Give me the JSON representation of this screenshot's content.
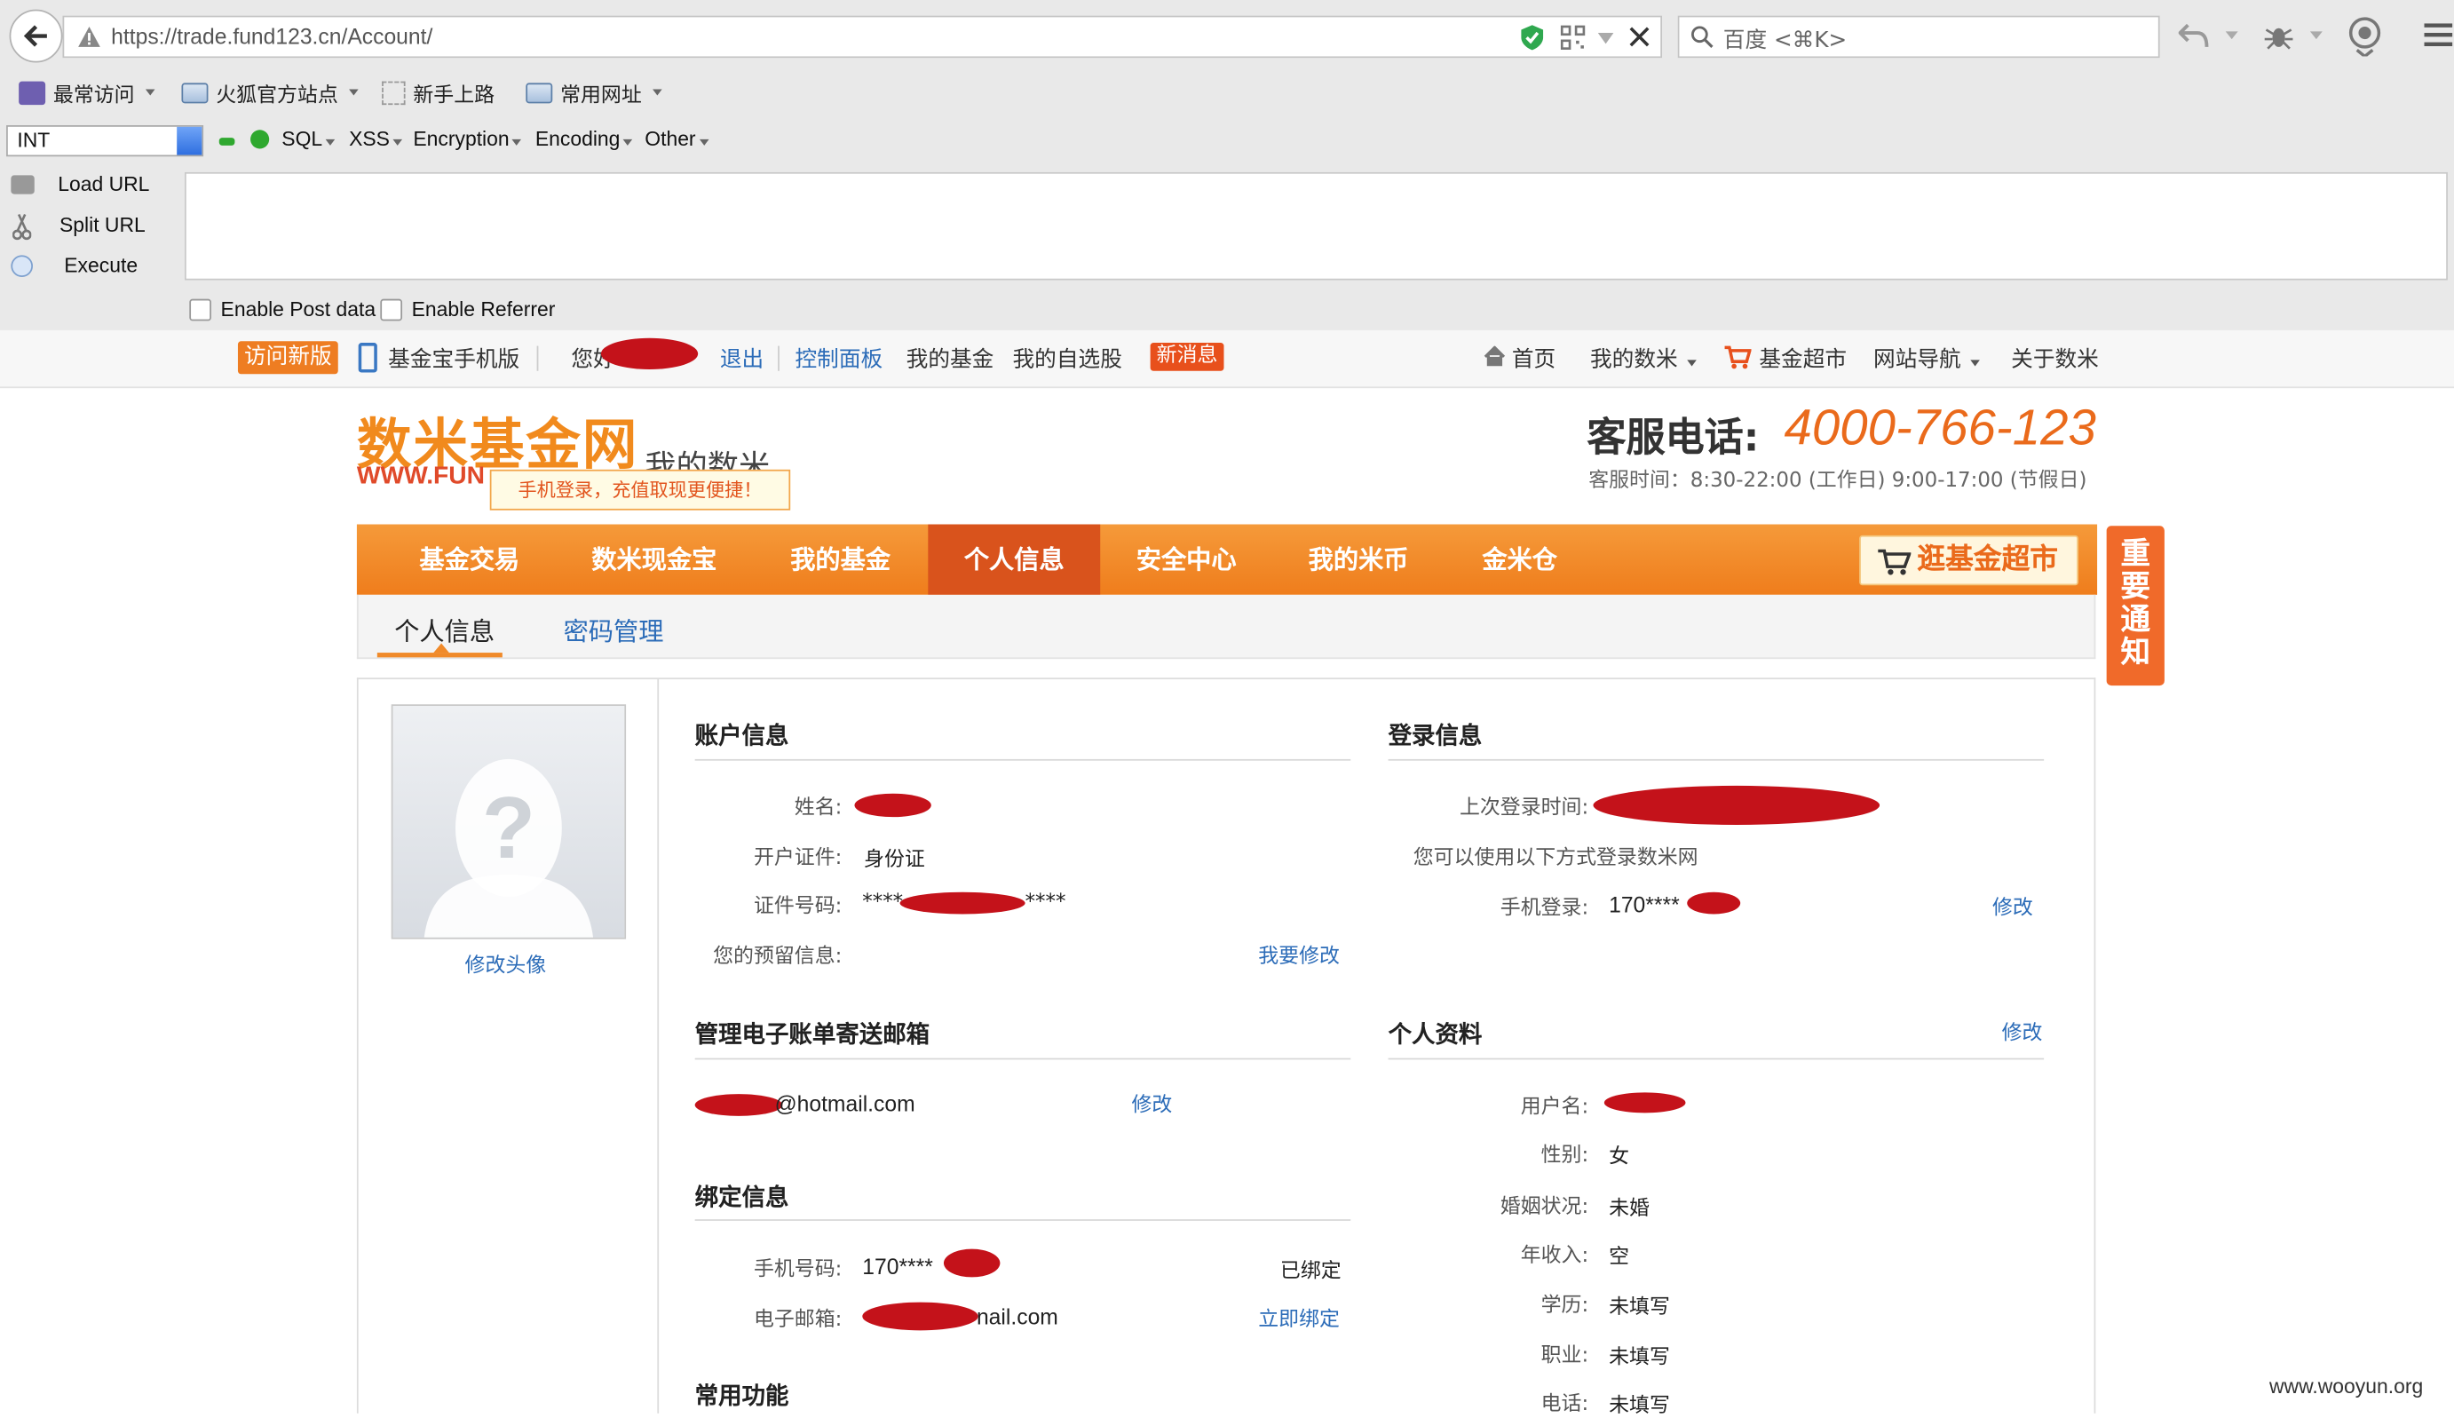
{
  "browser": {
    "url": "https://trade.fund123.cn/Account/",
    "search_placeholder": "百度 <⌘K>",
    "bookmarks": [
      "最常访问",
      "火狐官方站点",
      "新手上路",
      "常用网址"
    ]
  },
  "hackbar": {
    "select_value": "INT",
    "menus": [
      "SQL",
      "XSS",
      "Encryption",
      "Encoding",
      "Other"
    ],
    "side_buttons": [
      "Load URL",
      "Split URL",
      "Execute"
    ],
    "checkboxes": [
      "Enable Post data",
      "Enable Referrer"
    ]
  },
  "topbar": {
    "new_version": "访问新版",
    "mobile": "基金宝手机版",
    "greeting": "您好",
    "logout": "退出",
    "control_panel": "控制面板",
    "my_funds": "我的基金",
    "my_watchlist": "我的自选股",
    "new_message": "新消息",
    "home": "首页",
    "my_shumi": "我的数米",
    "fund_market": "基金超市",
    "site_nav": "网站导航",
    "about": "关于数米"
  },
  "header": {
    "logo": "数米基金网",
    "logo_url": "WWW.FUN",
    "section": "我的数米",
    "tip": "手机登录，充值取现更便捷！",
    "service_label": "客服电话:",
    "service_phone": "4000-766-123",
    "service_hours": "客服时间：8:30-22:00 (工作日) 9:00-17:00 (节假日)"
  },
  "nav": {
    "items": [
      "基金交易",
      "数米现金宝",
      "我的基金",
      "个人信息",
      "安全中心",
      "我的米币",
      "金米仓"
    ],
    "active": "个人信息",
    "market_button": "逛基金超市",
    "notice": "重要通知"
  },
  "subtabs": [
    "个人信息",
    "密码管理"
  ],
  "avatar": {
    "edit": "修改头像"
  },
  "account": {
    "title": "账户信息",
    "name_label": "姓名:",
    "id_type_label": "开户证件:",
    "id_type": "身份证",
    "id_number_label": "证件号码:",
    "id_number": "****",
    "id_number_tail": "****",
    "reserved_label": "您的预留信息:",
    "reserved_edit": "我要修改"
  },
  "email": {
    "title": "管理电子账单寄送邮箱",
    "value": "@hotmail.com",
    "edit": "修改"
  },
  "binding": {
    "title": "绑定信息",
    "phone_label": "手机号码:",
    "phone": "170****",
    "phone_status": "已绑定",
    "email_label": "电子邮箱:",
    "email": "nail.com",
    "email_action": "立即绑定"
  },
  "common": {
    "title": "常用功能"
  },
  "login": {
    "title": "登录信息",
    "last_login_label": "上次登录时间:",
    "methods_text": "您可以使用以下方式登录数米网",
    "mobile_label": "手机登录:",
    "mobile": "170****",
    "edit": "修改"
  },
  "profile": {
    "title": "个人资料",
    "edit": "修改",
    "rows": [
      {
        "label": "用户名:",
        "value": ""
      },
      {
        "label": "性别:",
        "value": "女"
      },
      {
        "label": "婚姻状况:",
        "value": "未婚"
      },
      {
        "label": "年收入:",
        "value": "空"
      },
      {
        "label": "学历:",
        "value": "未填写"
      },
      {
        "label": "职业:",
        "value": "未填写"
      },
      {
        "label": "电话:",
        "value": "未填写"
      }
    ]
  },
  "watermark": "www.wooyun.org"
}
